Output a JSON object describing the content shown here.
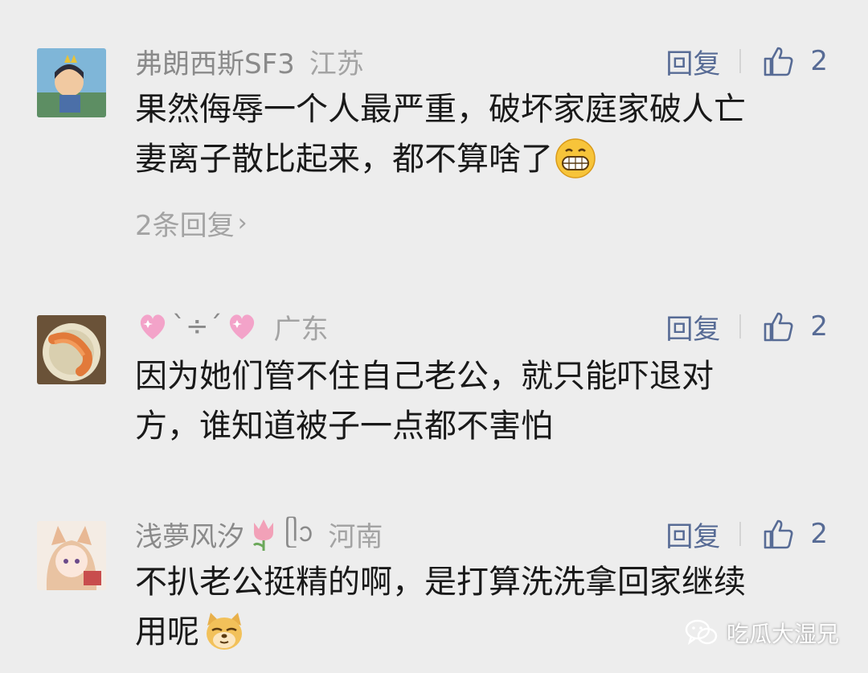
{
  "comments": [
    {
      "name": "弗朗西斯SF3",
      "region": "江苏",
      "reply_label": "回复",
      "likes": "2",
      "text_line1": "果然侮辱一个人最严重，破坏家庭家破人亡",
      "text_line2": "妻离子散比起来，都不算啥了",
      "emoji": "grin-emoji",
      "more_replies": "2条回复"
    },
    {
      "name_sep": "`÷´",
      "region": "广东",
      "reply_label": "回复",
      "likes": "2",
      "text_line1": "因为她们管不住自己老公，就只能吓退对",
      "text_line2": "方，谁知道被子一点都不害怕"
    },
    {
      "name": "浅夢风汐",
      "name_suffix": "ᥫᩣ",
      "region": "河南",
      "reply_label": "回复",
      "likes": "2",
      "text_line1": "不扒老公挺精的啊，是打算洗洗拿回家继续",
      "text_line2": "用呢",
      "emoji": "doge-emoji"
    }
  ],
  "watermark": {
    "text": "吃瓜大湿兄",
    "icon": "wechat-icon"
  },
  "colors": {
    "background": "#ededed",
    "link": "#576b95",
    "meta": "#8a8a8a",
    "text": "#191919"
  }
}
